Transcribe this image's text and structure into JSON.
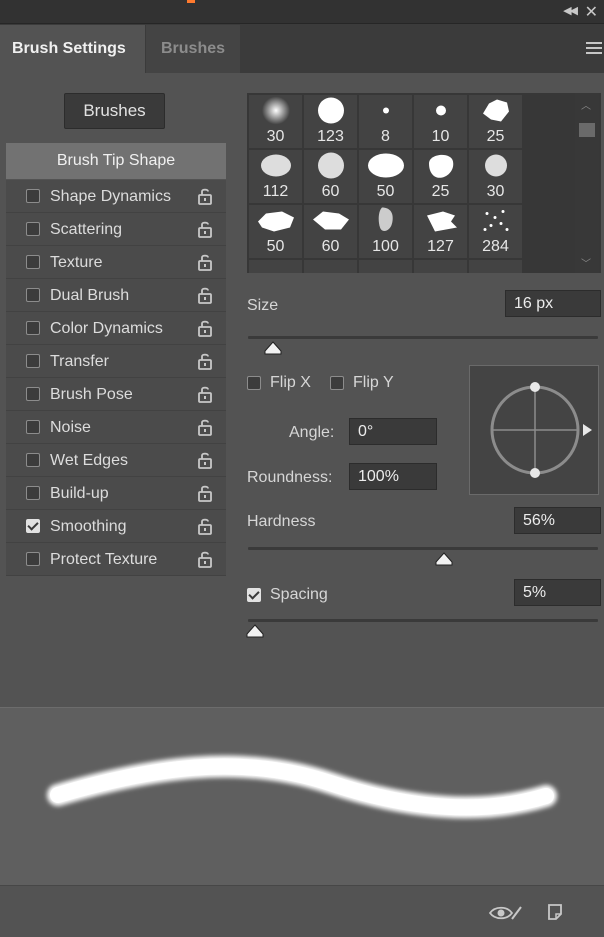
{
  "tabs": {
    "active": "Brush Settings",
    "inactive": "Brushes"
  },
  "brushes_button": "Brushes",
  "options": {
    "tip_shape": "Brush Tip Shape",
    "items": [
      {
        "label": "Shape Dynamics",
        "checked": false
      },
      {
        "label": "Scattering",
        "checked": false
      },
      {
        "label": "Texture",
        "checked": false
      },
      {
        "label": "Dual Brush",
        "checked": false
      },
      {
        "label": "Color Dynamics",
        "checked": false
      },
      {
        "label": "Transfer",
        "checked": false
      },
      {
        "label": "Brush Pose",
        "checked": false
      },
      {
        "label": "Noise",
        "checked": false
      },
      {
        "label": "Wet Edges",
        "checked": false
      },
      {
        "label": "Build-up",
        "checked": false
      },
      {
        "label": "Smoothing",
        "checked": true
      },
      {
        "label": "Protect Texture",
        "checked": false
      }
    ]
  },
  "presets": {
    "sizes": [
      "30",
      "123",
      "8",
      "10",
      "25",
      "112",
      "60",
      "50",
      "25",
      "30",
      "50",
      "60",
      "100",
      "127",
      "284"
    ]
  },
  "size": {
    "label": "Size",
    "value": "16 px",
    "slider_fraction": 0.07
  },
  "flip_x": {
    "label": "Flip X",
    "checked": false
  },
  "flip_y": {
    "label": "Flip Y",
    "checked": false
  },
  "angle": {
    "label": "Angle:",
    "value": "0°"
  },
  "roundness": {
    "label": "Roundness:",
    "value": "100%"
  },
  "hardness": {
    "label": "Hardness",
    "value": "56%",
    "slider_fraction": 0.56
  },
  "spacing": {
    "label": "Spacing",
    "value": "5%",
    "checked": true,
    "slider_fraction": 0.02
  },
  "colors": {
    "panel": "#535353",
    "accent": "#ff7a2e",
    "selected_item": "#727272"
  },
  "icons": [
    "collapse-icon",
    "close-icon",
    "panel-menu-icon",
    "lock-icon",
    "angle-arrow-icon",
    "toggle-visibility-icon",
    "new-preset-icon"
  ]
}
